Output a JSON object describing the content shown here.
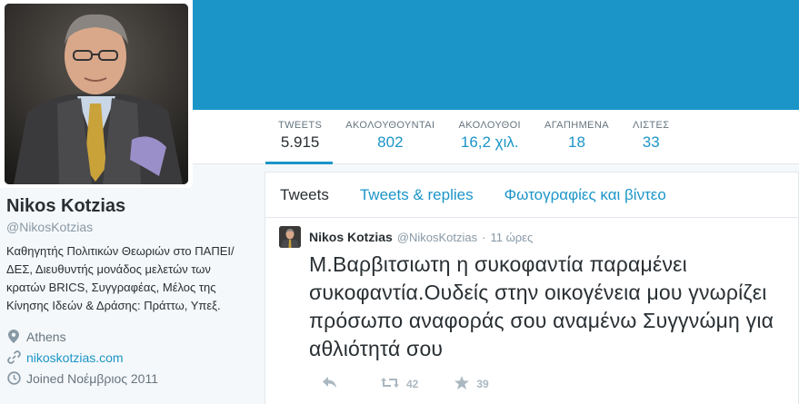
{
  "colors": {
    "accent": "#1b95c8",
    "text": "#292f33",
    "muted": "#8899a6",
    "action": "#aab8c2"
  },
  "profile": {
    "name": "Nikos Kotzias",
    "handle": "@NikosKotzias",
    "bio": "Καθηγητής Πολιτικών Θεωριών στο ΠΑΠΕΙ/ΔΕΣ, Διευθυντής μονάδος μελετών των κρατών BRICS, Συγγραφέας, Μέλος της Κίνησης Ιδεών & Δράσης: Πράττω, Υπεξ.",
    "location": "Athens",
    "location_icon": "location-pin-icon",
    "website": "nikoskotzias.com",
    "website_icon": "link-icon",
    "joined": "Joined Νοέμβριος 2011",
    "joined_icon": "calendar-icon"
  },
  "stats": [
    {
      "label": "TWEETS",
      "value": "5.915"
    },
    {
      "label": "ΑΚΟΛΟΥΘΟΥΝΤΑΙ",
      "value": "802"
    },
    {
      "label": "ΑΚΟΛΟΥΘΟΙ",
      "value": "16,2 χιλ."
    },
    {
      "label": "ΑΓΑΠΗΜΕΝΑ",
      "value": "18"
    },
    {
      "label": "ΛΙΣΤΕΣ",
      "value": "33"
    }
  ],
  "timeline": {
    "tabs": [
      "Tweets",
      "Tweets & replies",
      "Φωτογραφίες και βίντεο"
    ],
    "active_tab": "Tweets"
  },
  "tweet": {
    "name": "Nikos Kotzias",
    "handle": "@NikosKotzias",
    "separator": "·",
    "time": "11 ώρες",
    "text": "Μ.Βαρβιτσιωτη η συκοφαντία παραμένει συκοφαντία.Ουδείς στην οικογένεια μου γνωρίζει πρόσωπο αναφοράς σου αναμένω Συγγνώμη για αθλιότητά σου",
    "retweets": "42",
    "favorites": "39",
    "reply_icon": "reply-icon",
    "retweet_icon": "retweet-icon",
    "favorite_icon": "star-icon"
  }
}
